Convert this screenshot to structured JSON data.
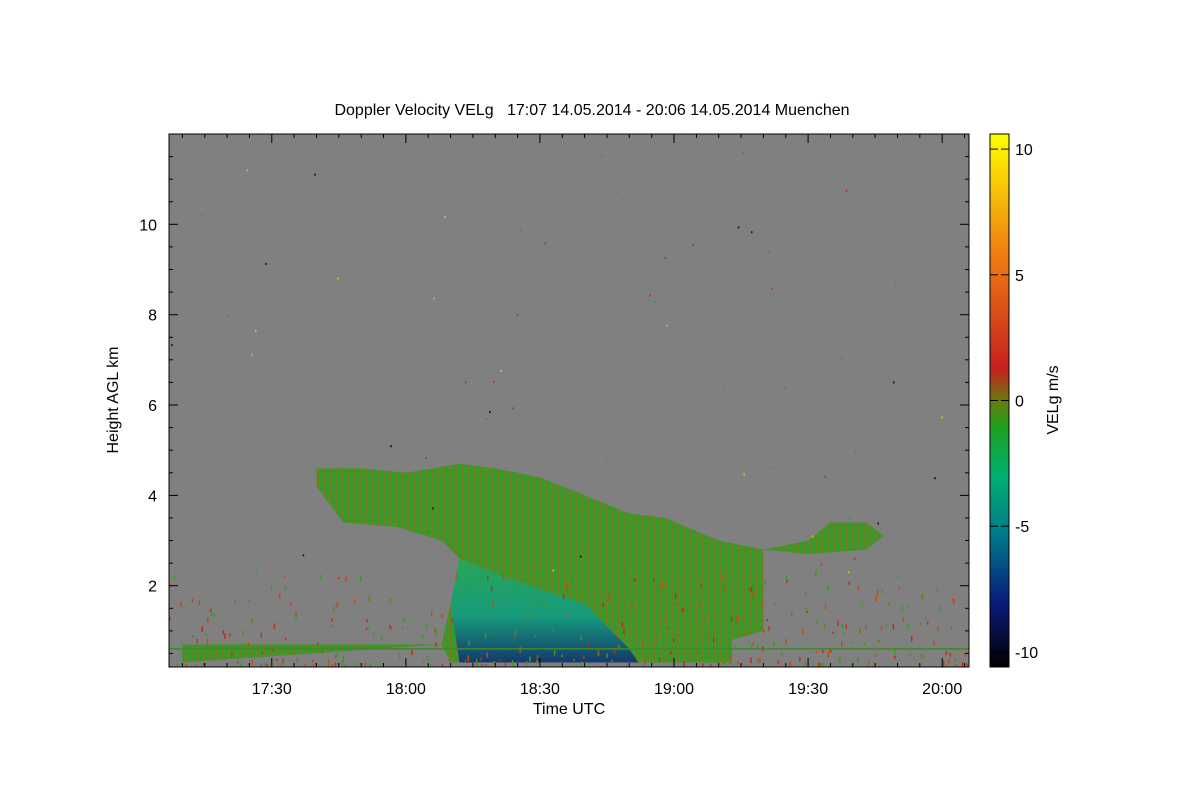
{
  "chart_data": {
    "type": "heatmap",
    "title": "Doppler Velocity VELg   17:07 14.05.2014 - 20:06 14.05.2014 Muenchen",
    "xlabel": "Time UTC",
    "ylabel": "Height AGL km",
    "x_ticks": [
      "17:30",
      "18:00",
      "18:30",
      "19:00",
      "19:30",
      "20:00"
    ],
    "y_ticks": [
      2,
      4,
      6,
      8,
      10
    ],
    "xlim": [
      "17:07",
      "20:06"
    ],
    "ylim": [
      0.2,
      12.0
    ],
    "background_color": "#808080",
    "colorbar": {
      "label": "VELg m/s",
      "ticks": [
        10,
        5,
        0,
        -5,
        -10
      ],
      "range": [
        -10.6,
        10.6
      ],
      "colors": [
        "#000000",
        "#0a1a7a",
        "#007a8a",
        "#00b070",
        "#1ea01e",
        "#6a7a10",
        "#c62020",
        "#f08010",
        "#ffff00"
      ]
    },
    "cloud_layer": {
      "value_range_mps": [
        -3,
        1
      ],
      "dominant_color": "#3a9a28",
      "outline": [
        [
          "17:10",
          0.3
        ],
        [
          "17:10",
          0.7
        ],
        [
          "17:40",
          0.7
        ],
        [
          "17:58",
          0.7
        ],
        [
          "18:08",
          0.7
        ],
        [
          "18:10",
          0.3
        ],
        [
          "19:13",
          0.3
        ],
        [
          "19:13",
          0.8
        ],
        [
          "19:20",
          1.0
        ],
        [
          "19:20",
          2.8
        ],
        [
          "19:30",
          3.0
        ],
        [
          "19:35",
          3.4
        ],
        [
          "19:43",
          3.4
        ],
        [
          "19:47",
          3.1
        ],
        [
          "19:43",
          2.8
        ],
        [
          "19:30",
          2.7
        ],
        [
          "19:20",
          2.8
        ],
        [
          "19:10",
          3.0
        ],
        [
          "18:58",
          3.5
        ],
        [
          "18:50",
          3.6
        ],
        [
          "18:40",
          4.0
        ],
        [
          "18:30",
          4.4
        ],
        [
          "18:20",
          4.6
        ],
        [
          "18:12",
          4.7
        ],
        [
          "18:00",
          4.5
        ],
        [
          "17:50",
          4.6
        ],
        [
          "17:40",
          4.6
        ],
        [
          "17:40",
          4.2
        ],
        [
          "17:46",
          3.4
        ],
        [
          "17:58",
          3.3
        ],
        [
          "18:08",
          3.0
        ],
        [
          "18:12",
          2.6
        ],
        [
          "18:10",
          1.6
        ],
        [
          "18:08",
          0.7
        ]
      ]
    },
    "fall_streak": {
      "value_range_mps": [
        -6,
        -2
      ],
      "outline": [
        [
          "18:12",
          2.6
        ],
        [
          "18:22",
          2.2
        ],
        [
          "18:40",
          1.6
        ],
        [
          "18:50",
          0.6
        ],
        [
          "18:52",
          0.3
        ],
        [
          "18:12",
          0.3
        ],
        [
          "18:10",
          1.6
        ]
      ]
    }
  }
}
